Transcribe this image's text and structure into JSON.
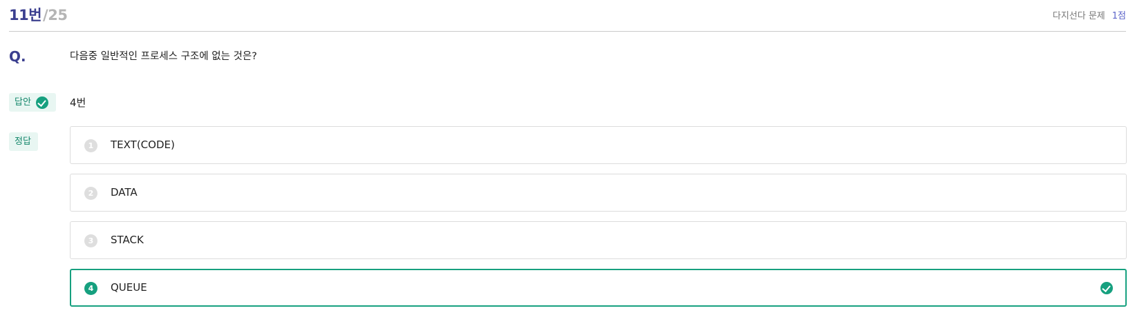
{
  "header": {
    "question_number": "11번",
    "total": "/25",
    "question_type": "다지선다 문제",
    "points": "1점"
  },
  "question": {
    "label": "Q.",
    "text": "다음중 일반적인 프로세스 구조에 없는 것은?"
  },
  "answer": {
    "tag_label": "답안",
    "value": "4번",
    "correct_tag_label": "정답"
  },
  "options": [
    {
      "number": "1",
      "label": "TEXT(CODE)",
      "selected": false
    },
    {
      "number": "2",
      "label": "DATA",
      "selected": false
    },
    {
      "number": "3",
      "label": "STACK",
      "selected": false
    },
    {
      "number": "4",
      "label": "QUEUE",
      "selected": true
    }
  ],
  "colors": {
    "accent": "#3b3f8f",
    "correct": "#16a07f",
    "tag_bg": "#e8f6f2"
  }
}
